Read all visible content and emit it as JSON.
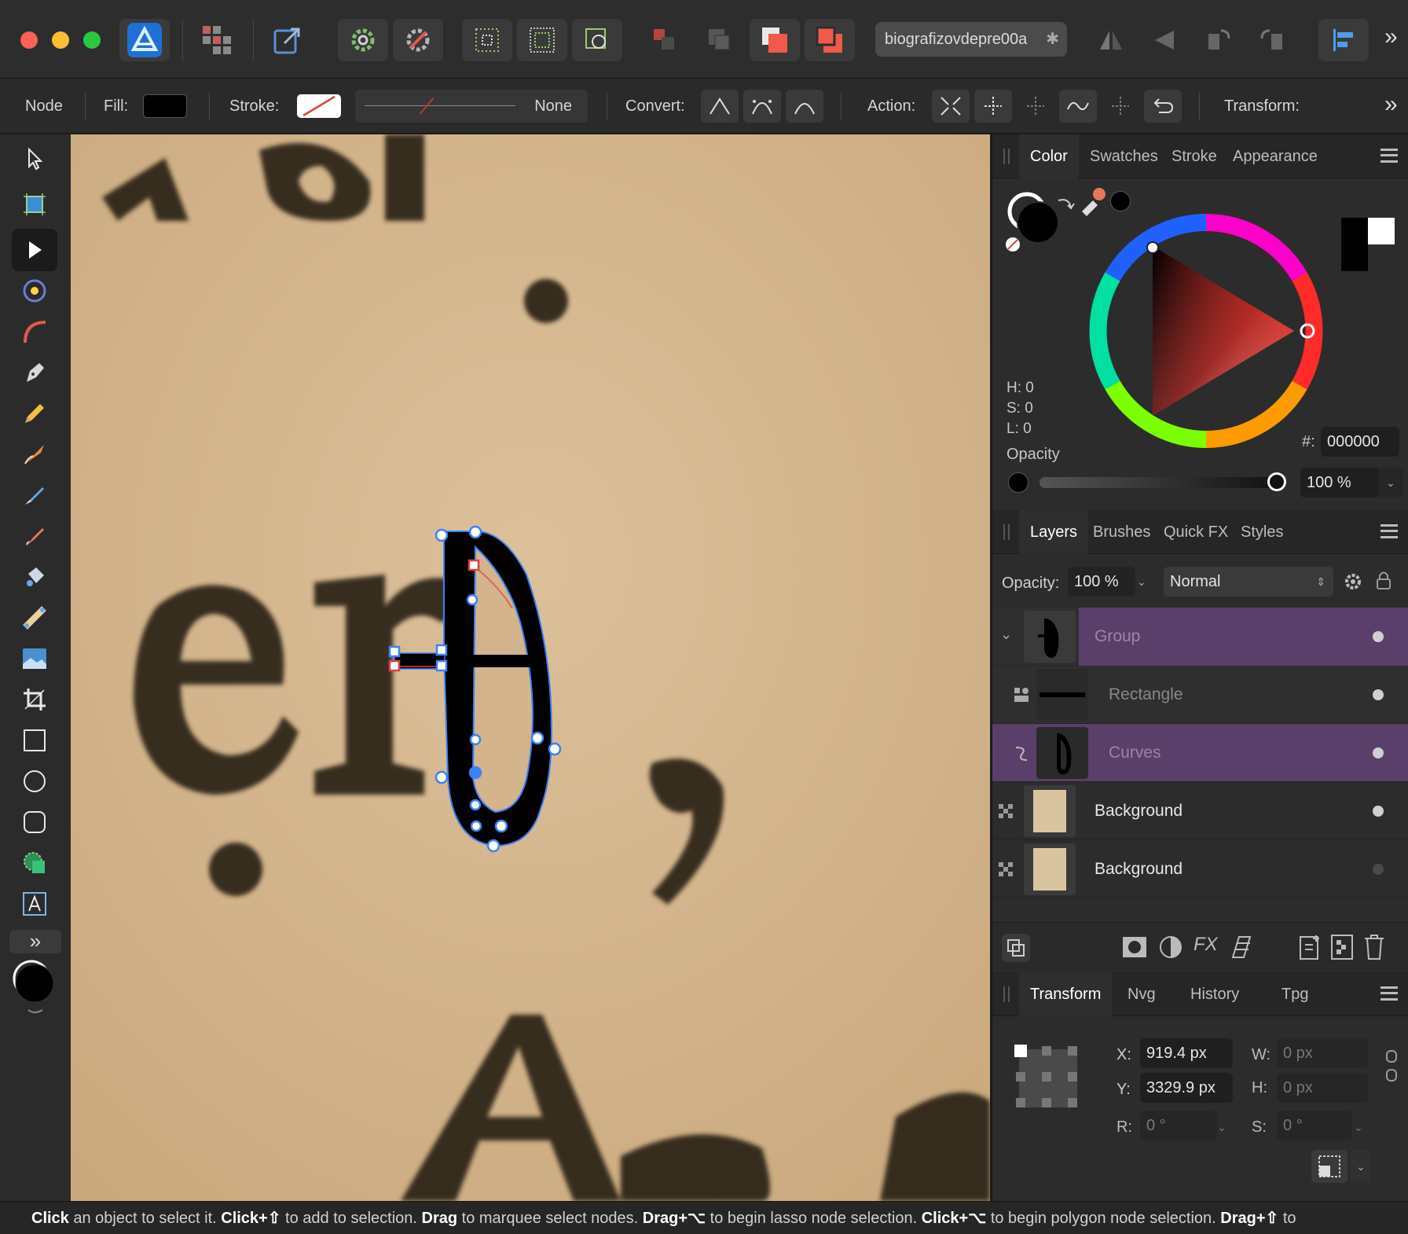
{
  "app": {
    "document_tab": "biografizovdepre00a",
    "document_tab_modified": "✱"
  },
  "context_toolbar": {
    "mode": "Node",
    "fill_label": "Fill:",
    "stroke_label": "Stroke:",
    "stroke_width_value": "None",
    "convert_label": "Convert:",
    "action_label": "Action:",
    "transform_label": "Transform:",
    "fill_color": "#000000"
  },
  "color_panel": {
    "tabs": [
      "Color",
      "Swatches",
      "Stroke",
      "Appearance"
    ],
    "active_tab": "Color",
    "h": "H: 0",
    "s": "S: 0",
    "l": "L: 0",
    "hex_label": "#:",
    "hex_value": "000000",
    "opacity_label": "Opacity",
    "opacity_value": "100 %"
  },
  "layers_panel": {
    "tabs": [
      "Layers",
      "Brushes",
      "Quick FX",
      "Styles"
    ],
    "active_tab": "Layers",
    "opacity_label": "Opacity:",
    "opacity_value": "100 %",
    "blend_mode": "Normal",
    "layers": [
      {
        "name": "Group",
        "selected": true
      },
      {
        "name": "Rectangle",
        "selected": false
      },
      {
        "name": "Curves",
        "selected": true
      },
      {
        "name": "Background",
        "selected": false
      },
      {
        "name": "Background",
        "selected": false
      }
    ]
  },
  "transform_panel": {
    "tabs": [
      "Transform",
      "Nvg",
      "History",
      "Tpg"
    ],
    "active_tab": "Transform",
    "x_label": "X:",
    "x_value": "919.4 px",
    "y_label": "Y:",
    "y_value": "3329.9 px",
    "w_label": "W:",
    "w_value": "0 px",
    "h_label": "H:",
    "h_value": "0 px",
    "r_label": "R:",
    "r_value": "0 °",
    "s_label": "S:",
    "s_value": "0 °"
  },
  "status_bar": {
    "parts": [
      {
        "bold": "Click",
        "text": " an object to select it. "
      },
      {
        "bold": "Click+⇧",
        "text": " to add to selection. "
      },
      {
        "bold": "Drag",
        "text": " to marquee select nodes. "
      },
      {
        "bold": "Drag+⌥",
        "text": " to begin lasso node selection. "
      },
      {
        "bold": "Click+⌥",
        "text": " to begin polygon node selection. "
      },
      {
        "bold": "Drag+⇧",
        "text": " to"
      }
    ]
  },
  "colors": {
    "accent_selection": "#6a4a7a",
    "node_blue": "#3b82f6",
    "canvas_paper": "#d3b48c"
  }
}
